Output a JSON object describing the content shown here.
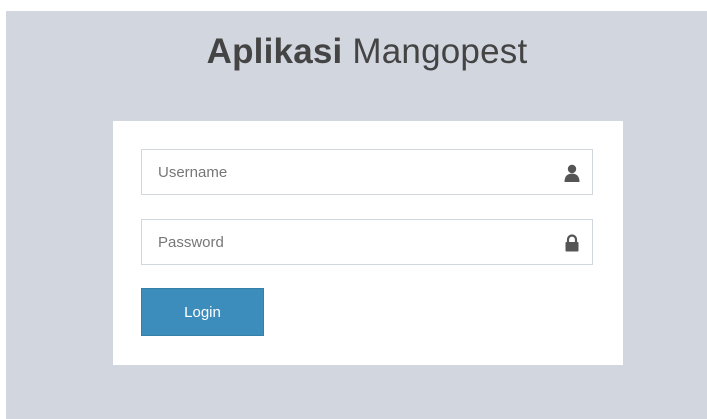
{
  "logo": {
    "bold": "Aplikasi",
    "light": "Mangopest"
  },
  "form": {
    "username": {
      "placeholder": "Username",
      "value": "",
      "icon": "user-icon"
    },
    "password": {
      "placeholder": "Password",
      "value": "",
      "icon": "lock-icon"
    },
    "login_label": "Login"
  },
  "colors": {
    "page_background": "#d2d6de",
    "box_background": "#ffffff",
    "button_primary": "#3c8dbc",
    "icon": "#555555"
  }
}
